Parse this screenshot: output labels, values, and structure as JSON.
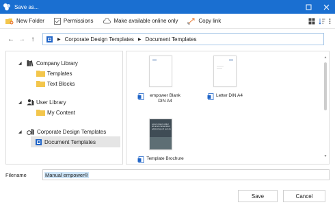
{
  "window": {
    "title": "Save as..."
  },
  "toolbar": {
    "new_folder": "New Folder",
    "permissions": "Permissions",
    "make_online": "Make available online only",
    "copy_link": "Copy link"
  },
  "breadcrumb": [
    "Corporate Design Templates",
    "Document Templates"
  ],
  "tree": {
    "company_library": "Company Library",
    "templates": "Templates",
    "text_blocks": "Text Blocks",
    "user_library": "User Library",
    "my_content": "My Content",
    "corporate_design_templates": "Corporate Design Templates",
    "document_templates": "Document Templates"
  },
  "files": [
    {
      "name": "empower Blank DIN A4"
    },
    {
      "name": "Letter DIN A4"
    },
    {
      "name": "Template Brochure"
    }
  ],
  "brochure_cover_text": "Lorem ipsum dolor sit amet consectetur adipiscing elit sed do",
  "filename": {
    "label": "Filename",
    "value": "Manual empower®"
  },
  "buttons": {
    "save": "Save",
    "cancel": "Cancel"
  },
  "colors": {
    "titlebar": "#1a6fd1",
    "folder": "#f3c64c",
    "selection": "#cce4f7",
    "doc_blue": "#1e64c8"
  },
  "icons": [
    "app-icon",
    "minimize-icon",
    "close-icon",
    "new-folder-icon",
    "permissions-icon",
    "cloud-icon",
    "copy-link-icon",
    "view-mode-icon",
    "sort-icon",
    "more-icon",
    "back-arrow-icon",
    "forward-arrow-icon",
    "up-arrow-icon",
    "location-icon",
    "library-icon",
    "folder-icon",
    "user-library-icon",
    "corporate-library-icon",
    "document-icon"
  ]
}
